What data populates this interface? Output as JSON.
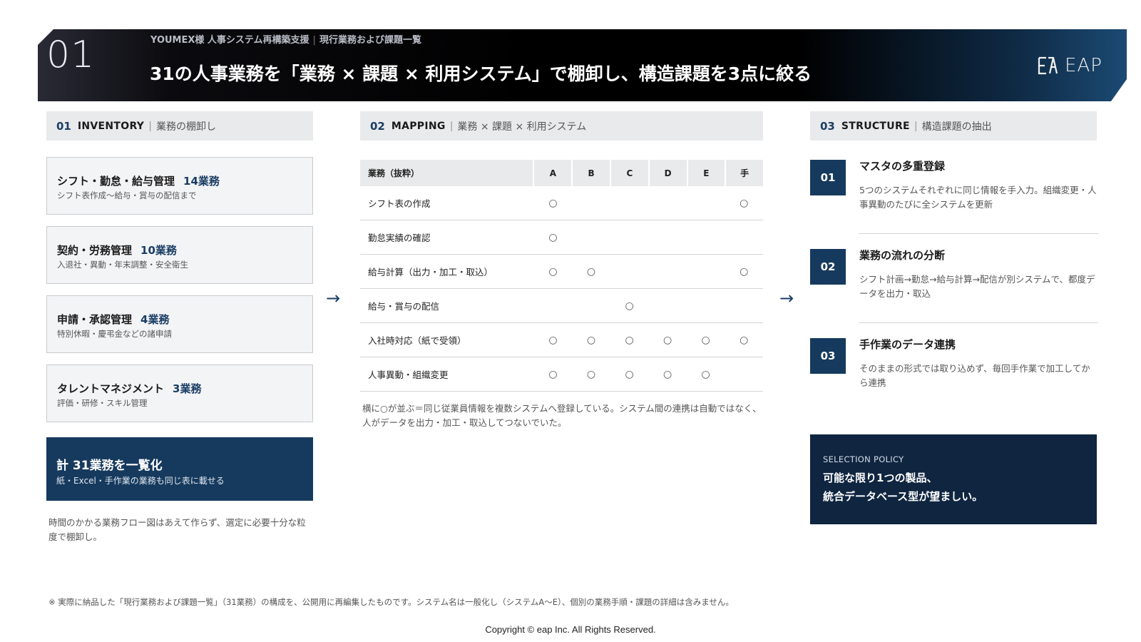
{
  "header": {
    "number": "01",
    "client": "YOUMEX様 人事システム再構築支援",
    "doc": "現行業務および課題一覧",
    "title": "31の人事業務を「業務 × 課題 × 利用システム」で棚卸し、構造課題を3点に絞る",
    "logo_text": "EAP"
  },
  "inventory": {
    "num": "01",
    "en": "INVENTORY",
    "jp": "業務の棚卸し",
    "cards": [
      {
        "title": "シフト・勤怠・給与管理",
        "count": "14業務",
        "desc": "シフト表作成〜給与・賞与の配信まで"
      },
      {
        "title": "契約・労務管理",
        "count": "10業務",
        "desc": "入退社・異動・年末調整・安全衛生"
      },
      {
        "title": "申請・承認管理",
        "count": "4業務",
        "desc": "特別休暇・慶弔金などの諸申請"
      },
      {
        "title": "タレントマネジメント",
        "count": "3業務",
        "desc": "評価・研修・スキル管理"
      }
    ],
    "total_title": "計 31業務を一覧化",
    "total_desc": "紙・Excel・手作業の業務も同じ表に載せる",
    "note": "時間のかかる業務フロー図はあえて作らず、選定に必要十分な粒度で棚卸し。"
  },
  "arrow_glyph": "→",
  "mapping": {
    "num": "02",
    "en": "MAPPING",
    "jp": "業務 × 課題 × 利用システム",
    "header_task": "業務（抜粋）",
    "systems": [
      "A",
      "B",
      "C",
      "D",
      "E",
      "手"
    ],
    "mark": "○",
    "rows": [
      {
        "task": "シフト表の作成",
        "marks": [
          1,
          0,
          0,
          0,
          0,
          1
        ]
      },
      {
        "task": "勤怠実績の確認",
        "marks": [
          1,
          0,
          0,
          0,
          0,
          0
        ]
      },
      {
        "task": "給与計算（出力・加工・取込）",
        "marks": [
          1,
          1,
          0,
          0,
          0,
          1
        ]
      },
      {
        "task": "給与・賞与の配信",
        "marks": [
          0,
          0,
          1,
          0,
          0,
          0
        ]
      },
      {
        "task": "入社時対応（紙で受領）",
        "marks": [
          1,
          1,
          1,
          1,
          1,
          1
        ]
      },
      {
        "task": "人事異動・組織変更",
        "marks": [
          1,
          1,
          1,
          1,
          1,
          0
        ]
      }
    ],
    "note": "横に○が並ぶ＝同じ従業員情報を複数システムへ登録している。システム間の連携は自動ではなく、人がデータを出力・加工・取込してつないでいた。"
  },
  "structure": {
    "num": "03",
    "en": "STRUCTURE",
    "jp": "構造課題の抽出",
    "issues": [
      {
        "num": "01",
        "title": "マスタの多重登録",
        "desc": "5つのシステムそれぞれに同じ情報を手入力。組織変更・人事異動のたびに全システムを更新"
      },
      {
        "num": "02",
        "title": "業務の流れの分断",
        "desc": "シフト計画→勤怠→給与計算→配信が別システムで、都度データを出力・取込"
      },
      {
        "num": "03",
        "title": "手作業のデータ連携",
        "desc": "そのままの形式では取り込めず、毎回手作業で加工してから連携"
      }
    ],
    "policy_label": "SELECTION POLICY",
    "policy_line1": "可能な限り1つの製品、",
    "policy_line2": "統合データベース型が望ましい。"
  },
  "footer": {
    "note": "※ 実際に納品した「現行業務および課題一覧」（31業務）の構成を、公開用に再編集したものです。システム名は一般化し（システムA〜E）、個別の業務手順・課題の詳細は含みません。",
    "copyright": "Copyright © eap Inc. All Rights Reserved."
  }
}
